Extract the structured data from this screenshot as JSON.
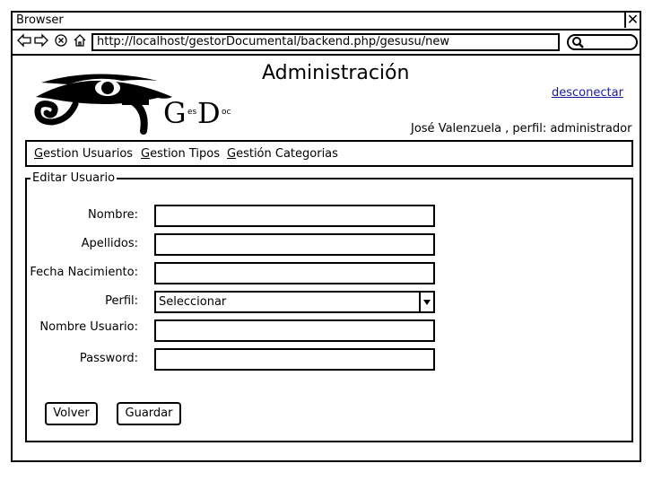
{
  "browser": {
    "title": "Browser",
    "close_icon": "✕",
    "url": "http://localhost/gestorDocumental/backend.php/gesusu/new"
  },
  "header": {
    "title": "Administración",
    "logout_label": "desconectar",
    "user_info": "José Valenzuela , perfil: administrador",
    "logo": {
      "text_g": "G",
      "text_es": "es",
      "text_d": "D",
      "text_oc": "oc"
    }
  },
  "menu": {
    "items": [
      {
        "first": "G",
        "rest": "estion Usuarios"
      },
      {
        "first": "G",
        "rest": "estion Tipos"
      },
      {
        "first": "G",
        "rest": "estión Categorias"
      }
    ]
  },
  "form": {
    "legend": "Editar Usuario",
    "fields": {
      "nombre": {
        "label": "Nombre:",
        "value": ""
      },
      "apellidos": {
        "label": "Apellidos:",
        "value": ""
      },
      "fecha": {
        "label": "Fecha Nacimiento:",
        "value": ""
      },
      "perfil": {
        "label": "Perfil:",
        "selected": "Seleccionar"
      },
      "usuario": {
        "label": "Nombre Usuario:",
        "value": ""
      },
      "password": {
        "label": "Password:",
        "value": ""
      }
    },
    "buttons": {
      "back": "Volver",
      "save": "Guardar"
    }
  }
}
